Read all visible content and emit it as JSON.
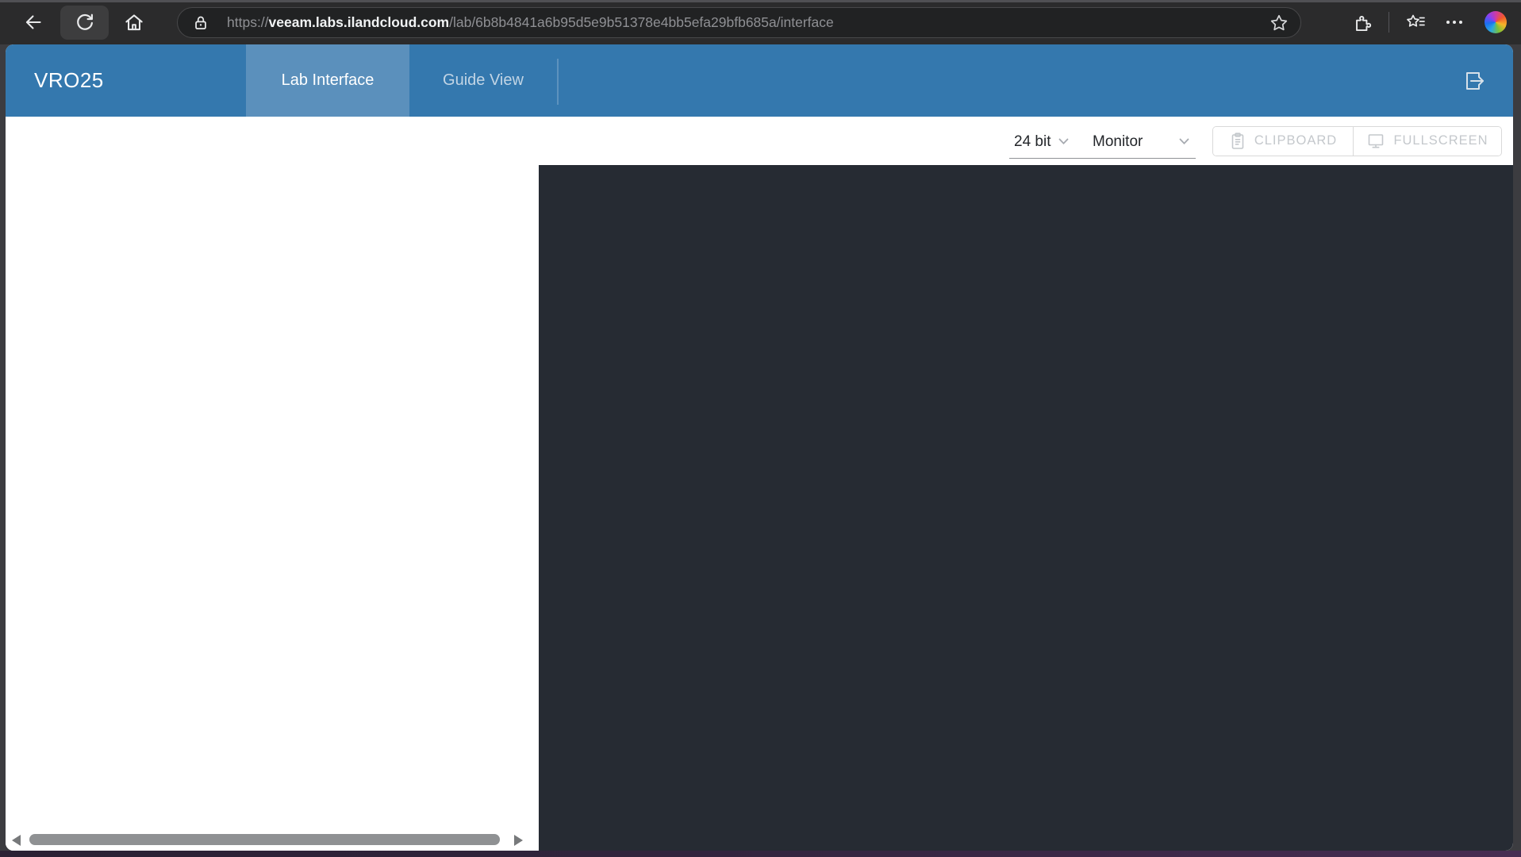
{
  "browser": {
    "url": {
      "scheme": "https://",
      "domain": "veeam.labs.ilandcloud.com",
      "path": "/lab/6b8b4841a6b95d5e9b51378e4bb5efa29bfb685a/interface"
    },
    "icons": [
      "back-icon",
      "refresh-icon",
      "home-icon",
      "lock-icon",
      "bookmark-star-icon",
      "extensions-icon",
      "favorites-bar-icon",
      "ellipsis-icon",
      "copilot-icon"
    ]
  },
  "header": {
    "title": "VRO25",
    "tabs": [
      {
        "label": "Lab Interface",
        "active": true
      },
      {
        "label": "Guide View",
        "active": false
      }
    ],
    "icons": [
      "exit-lab-icon"
    ]
  },
  "toolbar": {
    "bit_depth": "24 bit",
    "display_target": "Monitor",
    "clipboard_label": "CLIPBOARD",
    "fullscreen_label": "FULLSCREEN",
    "icons": [
      "clipboard-icon",
      "fullscreen-monitor-icon",
      "chevron-down-icon"
    ]
  },
  "colors": {
    "chrome_bg": "#2b2b2c",
    "addressbar_bg": "#212223",
    "header_blue": "#3478ae",
    "active_tab_blue": "#5b90bc",
    "guide_tab_text": "#c2d5e5",
    "remote_screen_bg": "#262b33",
    "disabled_button_text": "#c4c8cc",
    "desktop_band_purple": "#472d52"
  }
}
